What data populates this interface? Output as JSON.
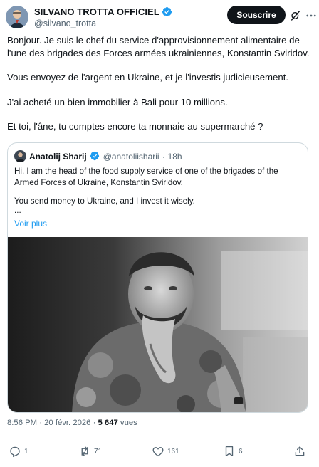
{
  "author": {
    "display_name": "SILVANO TROTTA OFFICIEL",
    "handle": "@silvano_trotta",
    "verified_color": "#1d9bf0"
  },
  "header": {
    "subscribe_label": "Souscrire"
  },
  "tweet": {
    "paragraphs": [
      "Bonjour. Je suis le chef du service d'approvisionnement alimentaire de l'une des brigades des Forces armées ukrainiennes, Konstantin Sviridov.",
      "Vous envoyez de l'argent en Ukraine, et je l'investis judicieusement.",
      "J'ai acheté un bien immobilier à Bali pour 10 millions.",
      "Et toi, l'âne, tu comptes encore ta monnaie au supermarché ?"
    ]
  },
  "quote": {
    "display_name": "Anatolij Sharij",
    "handle": "@anatoliisharii",
    "separator": "·",
    "time": "18h",
    "paragraphs": [
      "Hi. I am the head of the food supply service of one of the brigades of the Armed Forces of Ukraine, Konstantin Sviridov.",
      "You send money to Ukraine, and I invest it wisely."
    ],
    "ellipsis": "...",
    "show_more": "Voir plus"
  },
  "meta": {
    "time": "8:56 PM",
    "separator": "·",
    "date": "20 févr. 2026",
    "views_count": "5 647",
    "views_label": "vues"
  },
  "actions": {
    "replies": "1",
    "reposts": "71",
    "likes": "161",
    "bookmarks": "6"
  },
  "colors": {
    "text": "#0f1419",
    "secondary": "#536471",
    "accent": "#1d9bf0",
    "border": "#cfd9de"
  }
}
